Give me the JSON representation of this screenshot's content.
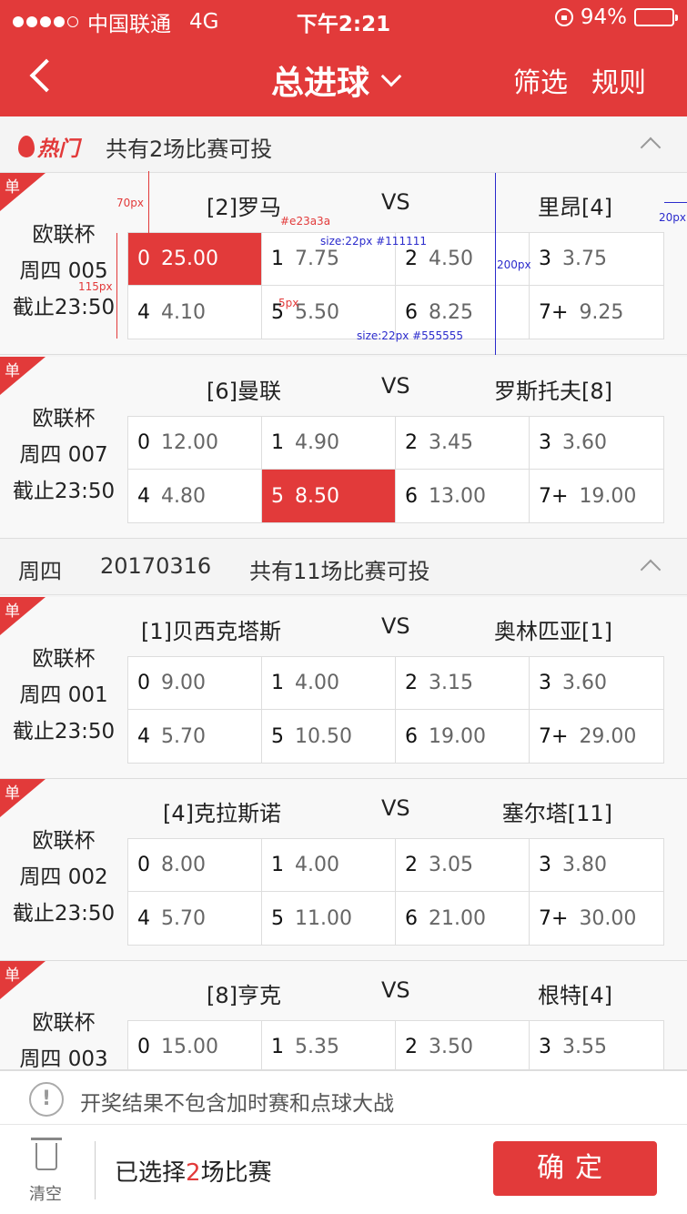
{
  "status_bar": {
    "carrier": "中国联通",
    "network": "4G",
    "time": "下午2:21",
    "battery": "94%"
  },
  "nav": {
    "title": "总进球",
    "filter": "筛选",
    "rules": "规则"
  },
  "hot_section": {
    "badge": "热门",
    "summary": "共有2场比赛可投"
  },
  "day_section": {
    "weekday": "周四",
    "date": "20170316",
    "summary": "共有11场比赛可投"
  },
  "matches": [
    {
      "tag": "单",
      "league": "欧联杯",
      "code": "周四 005",
      "deadline": "截止23:50",
      "home": "[2]罗马",
      "vs": "VS",
      "away": "里昂[4]",
      "odds": [
        {
          "k": "0",
          "v": "25.00"
        },
        {
          "k": "1",
          "v": "7.75"
        },
        {
          "k": "2",
          "v": "4.50"
        },
        {
          "k": "3",
          "v": "3.75"
        },
        {
          "k": "4",
          "v": "4.10"
        },
        {
          "k": "5",
          "v": "5.50"
        },
        {
          "k": "6",
          "v": "8.25"
        },
        {
          "k": "7+",
          "v": "9.25"
        }
      ],
      "selected": 0
    },
    {
      "tag": "单",
      "league": "欧联杯",
      "code": "周四 007",
      "deadline": "截止23:50",
      "home": "[6]曼联",
      "vs": "VS",
      "away": "罗斯托夫[8]",
      "odds": [
        {
          "k": "0",
          "v": "12.00"
        },
        {
          "k": "1",
          "v": "4.90"
        },
        {
          "k": "2",
          "v": "3.45"
        },
        {
          "k": "3",
          "v": "3.60"
        },
        {
          "k": "4",
          "v": "4.80"
        },
        {
          "k": "5",
          "v": "8.50"
        },
        {
          "k": "6",
          "v": "13.00"
        },
        {
          "k": "7+",
          "v": "19.00"
        }
      ],
      "selected": 5
    },
    {
      "tag": "单",
      "league": "欧联杯",
      "code": "周四 001",
      "deadline": "截止23:50",
      "home": "[1]贝西克塔斯",
      "vs": "VS",
      "away": "奥林匹亚[1]",
      "odds": [
        {
          "k": "0",
          "v": "9.00"
        },
        {
          "k": "1",
          "v": "4.00"
        },
        {
          "k": "2",
          "v": "3.15"
        },
        {
          "k": "3",
          "v": "3.60"
        },
        {
          "k": "4",
          "v": "5.70"
        },
        {
          "k": "5",
          "v": "10.50"
        },
        {
          "k": "6",
          "v": "19.00"
        },
        {
          "k": "7+",
          "v": "29.00"
        }
      ],
      "selected": -1
    },
    {
      "tag": "单",
      "league": "欧联杯",
      "code": "周四 002",
      "deadline": "截止23:50",
      "home": "[4]克拉斯诺",
      "vs": "VS",
      "away": "塞尔塔[11]",
      "odds": [
        {
          "k": "0",
          "v": "8.00"
        },
        {
          "k": "1",
          "v": "4.00"
        },
        {
          "k": "2",
          "v": "3.05"
        },
        {
          "k": "3",
          "v": "3.80"
        },
        {
          "k": "4",
          "v": "5.70"
        },
        {
          "k": "5",
          "v": "11.00"
        },
        {
          "k": "6",
          "v": "21.00"
        },
        {
          "k": "7+",
          "v": "30.00"
        }
      ],
      "selected": -1
    },
    {
      "tag": "单",
      "league": "欧联杯",
      "code": "周四 003",
      "deadline": "截止23:50",
      "home": "[8]亨克",
      "vs": "VS",
      "away": "根特[4]",
      "odds": [
        {
          "k": "0",
          "v": "15.00"
        },
        {
          "k": "1",
          "v": "5.35"
        },
        {
          "k": "2",
          "v": "3.50"
        },
        {
          "k": "3",
          "v": "3.55"
        },
        {
          "k": "4",
          "v": "",
          "kk": ""
        },
        {
          "k": "",
          "v": ""
        },
        {
          "k": "",
          "v": ""
        },
        {
          "k": "",
          "v": ""
        }
      ],
      "selected": -1
    }
  ],
  "annotations": {
    "a70": "70px",
    "a115": "115px",
    "color": "#e23a3a",
    "size1": "size:22px  #111111",
    "a200": "200px",
    "a20": "20px",
    "a5": "5px",
    "size2": "size:22px #555555"
  },
  "notice": "开奖结果不包含加时赛和点球大战",
  "footer": {
    "clear": "清空",
    "selected_prefix": "已选择",
    "selected_count": "2",
    "selected_suffix": "场比赛",
    "confirm": "确定"
  },
  "colors": {
    "accent": "#e23a3a",
    "odds_key": "#111111",
    "odds_value": "#555555"
  }
}
